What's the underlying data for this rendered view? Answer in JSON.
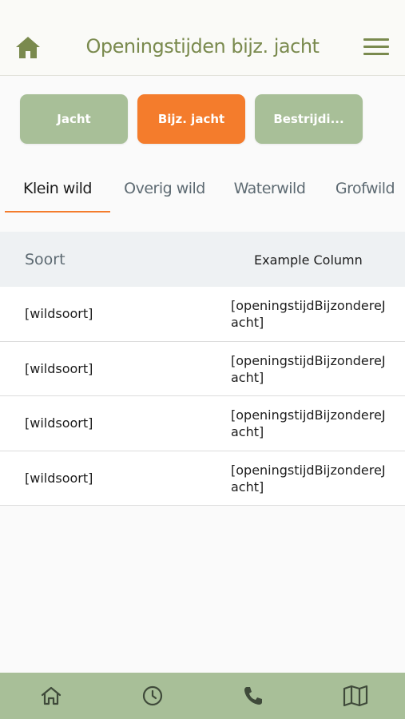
{
  "header": {
    "title": "Openingstijden bijz. jacht",
    "home_icon": "home-icon",
    "menu_icon": "menu-icon",
    "accent_color": "#7a8a4e"
  },
  "categories": [
    {
      "label": "Jacht",
      "active": false
    },
    {
      "label": "Bijz. jacht",
      "active": true
    },
    {
      "label": "Bestrijdi...",
      "active": false
    }
  ],
  "colors": {
    "category_inactive": "#a8bf98",
    "category_active": "#f47c2c",
    "bottom_nav": "#a8bf98"
  },
  "tabs": [
    {
      "label": "Klein wild",
      "active": true
    },
    {
      "label": "Overig wild",
      "active": false
    },
    {
      "label": "Waterwild",
      "active": false
    },
    {
      "label": "Grofwild",
      "active": false
    }
  ],
  "table": {
    "headers": {
      "soort": "Soort",
      "example": "Example Column"
    },
    "rows": [
      {
        "soort": "[wildsoort]",
        "time": "[openingstijdBijzondereJacht]"
      },
      {
        "soort": "[wildsoort]",
        "time": "[openingstijdBijzondereJacht]"
      },
      {
        "soort": "[wildsoort]",
        "time": "[openingstijdBijzondereJacht]"
      },
      {
        "soort": "[wildsoort]",
        "time": "[openingstijdBijzondereJacht]"
      }
    ]
  },
  "bottom_nav": [
    {
      "icon": "home-icon"
    },
    {
      "icon": "clock-icon"
    },
    {
      "icon": "phone-icon"
    },
    {
      "icon": "map-icon"
    }
  ]
}
